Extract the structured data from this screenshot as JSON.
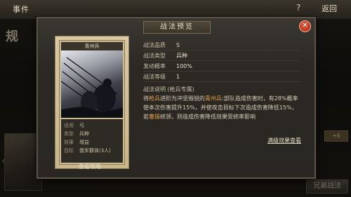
{
  "topbar": {
    "title": "事件",
    "help": "?",
    "back": "返回"
  },
  "background": {
    "big_char": "规",
    "right_tag": "+6",
    "switch_button": "兄弟战法"
  },
  "modal": {
    "title": "战法预览",
    "close": "✕",
    "card": {
      "name": "青州兵",
      "info": [
        {
          "key": "适用",
          "value": "弓"
        },
        {
          "key": "类型",
          "value": "兵种"
        },
        {
          "key": "效果",
          "value": "增益"
        },
        {
          "key": "目标",
          "value": "我军群体(3人)"
        }
      ]
    },
    "rows": [
      {
        "key": "战法品质",
        "value": "S"
      },
      {
        "key": "战法类型",
        "value": "兵种"
      },
      {
        "key": "发动概率",
        "value": "100%"
      },
      {
        "key": "战法等级",
        "value": "1"
      }
    ],
    "desc_label": "战法说明",
    "desc_note": "(枪兵专属)",
    "desc_parts": {
      "p1": "将",
      "h1": "枪兵",
      "p2": "进阶为冲坚毁锐的",
      "h2": "青州兵",
      "p3": ":部队造成伤害时，有28%概率使本次伤害提升15%，并使攻击目标下次造成伤害降低15%，若",
      "h3": "曹操",
      "p4": "统领，则造成伤害降低效果受统率影响"
    },
    "upgrade_link": "满级效果查看",
    "guide_link": "查看攻略"
  }
}
